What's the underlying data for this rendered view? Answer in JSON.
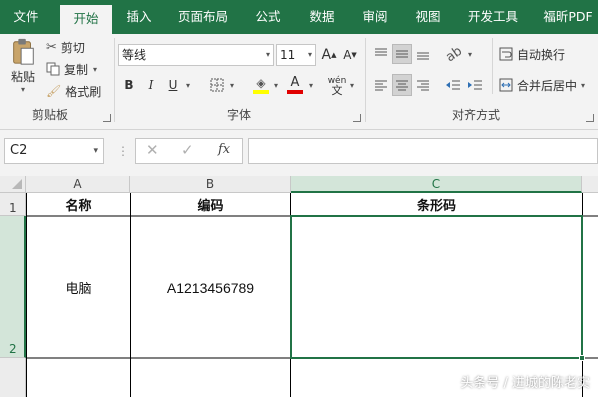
{
  "tabs": [
    "文件",
    "开始",
    "插入",
    "页面布局",
    "公式",
    "数据",
    "审阅",
    "视图",
    "开发工具",
    "福昕PDF"
  ],
  "clipboard": {
    "paste_label": "粘贴",
    "cut_label": "剪切",
    "copy_label": "复制",
    "format_painter_label": "格式刷",
    "group_label": "剪贴板"
  },
  "font": {
    "font_name": "等线",
    "font_size": "11",
    "bold": "B",
    "italic": "I",
    "underline": "U",
    "phonetic": "wén",
    "group_label": "字体"
  },
  "alignment": {
    "wrap_text_label": "自动换行",
    "merge_center_label": "合并后居中",
    "group_label": "对齐方式"
  },
  "formula_bar": {
    "name_box": "C2",
    "fx": "fx",
    "formula": ""
  },
  "grid": {
    "columns": [
      "A",
      "B",
      "C"
    ],
    "rows": [
      "1",
      "2"
    ],
    "header_row": [
      "名称",
      "编码",
      "条形码"
    ],
    "data_row": [
      "电脑",
      "A1213456789",
      ""
    ]
  },
  "watermark": "头条号 / 进城的陈老实",
  "colors": {
    "excel_green": "#217346",
    "ribbon_bg": "#f3f3f3",
    "selection_header": "#d3e5d9"
  }
}
